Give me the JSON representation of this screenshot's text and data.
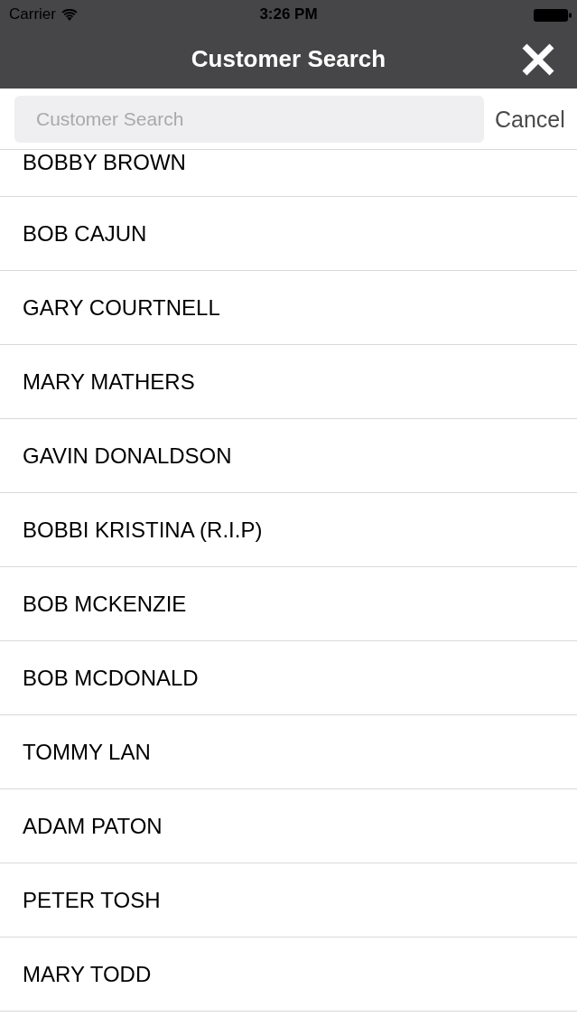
{
  "status_bar": {
    "carrier": "Carrier",
    "time": "3:26 PM"
  },
  "nav_bar": {
    "title": "Customer Search"
  },
  "search": {
    "placeholder": "Customer Search",
    "cancel": "Cancel"
  },
  "customers": [
    "BOBBY BROWN",
    "BOB CAJUN",
    "GARY COURTNELL",
    "MARY MATHERS",
    "GAVIN DONALDSON",
    "BOBBI KRISTINA (R.I.P)",
    "BOB MCKENZIE",
    "BOB MCDONALD",
    "TOMMY LAN",
    "ADAM PATON",
    "PETER TOSH",
    "MARY TODD"
  ]
}
